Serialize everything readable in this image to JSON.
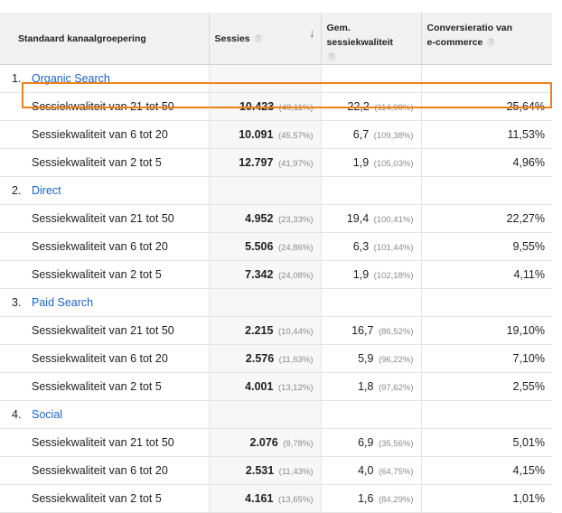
{
  "headers": {
    "channel": "Standaard kanaalgroepering",
    "sessions": "Sessies",
    "quality": "Gem. sessiekwaliteit",
    "conversion_line1": "Conversieratio van",
    "conversion_line2": "e-commerce",
    "help_glyph": "?",
    "sort_glyph": "↓"
  },
  "groups": [
    {
      "num": "1.",
      "name": "Organic Search",
      "rows": [
        {
          "label": "Sessiekwaliteit van 21 tot 50",
          "sessions": "10.423",
          "sessions_pct": "(49,11%)",
          "quality": "22,2",
          "quality_pct": "(114,98%)",
          "conversion": "25,64%"
        },
        {
          "label": "Sessiekwaliteit van 6 tot 20",
          "sessions": "10.091",
          "sessions_pct": "(45,57%)",
          "quality": "6,7",
          "quality_pct": "(109,38%)",
          "conversion": "11,53%"
        },
        {
          "label": "Sessiekwaliteit van 2 tot 5",
          "sessions": "12.797",
          "sessions_pct": "(41,97%)",
          "quality": "1,9",
          "quality_pct": "(105,03%)",
          "conversion": "4,96%"
        }
      ]
    },
    {
      "num": "2.",
      "name": "Direct",
      "rows": [
        {
          "label": "Sessiekwaliteit van 21 tot 50",
          "sessions": "4.952",
          "sessions_pct": "(23,33%)",
          "quality": "19,4",
          "quality_pct": "(100,41%)",
          "conversion": "22,27%"
        },
        {
          "label": "Sessiekwaliteit van 6 tot 20",
          "sessions": "5.506",
          "sessions_pct": "(24,86%)",
          "quality": "6,3",
          "quality_pct": "(101,44%)",
          "conversion": "9,55%"
        },
        {
          "label": "Sessiekwaliteit van 2 tot 5",
          "sessions": "7.342",
          "sessions_pct": "(24,08%)",
          "quality": "1,9",
          "quality_pct": "(102,18%)",
          "conversion": "4,11%"
        }
      ]
    },
    {
      "num": "3.",
      "name": "Paid Search",
      "rows": [
        {
          "label": "Sessiekwaliteit van 21 tot 50",
          "sessions": "2.215",
          "sessions_pct": "(10,44%)",
          "quality": "16,7",
          "quality_pct": "(86,52%)",
          "conversion": "19,10%"
        },
        {
          "label": "Sessiekwaliteit van 6 tot 20",
          "sessions": "2.576",
          "sessions_pct": "(11,63%)",
          "quality": "5,9",
          "quality_pct": "(96,22%)",
          "conversion": "7,10%"
        },
        {
          "label": "Sessiekwaliteit van 2 tot 5",
          "sessions": "4.001",
          "sessions_pct": "(13,12%)",
          "quality": "1,8",
          "quality_pct": "(97,62%)",
          "conversion": "2,55%"
        }
      ]
    },
    {
      "num": "4.",
      "name": "Social",
      "rows": [
        {
          "label": "Sessiekwaliteit van 21 tot 50",
          "sessions": "2.076",
          "sessions_pct": "(9,78%)",
          "quality": "6,9",
          "quality_pct": "(35,56%)",
          "conversion": "5,01%"
        },
        {
          "label": "Sessiekwaliteit van 6 tot 20",
          "sessions": "2.531",
          "sessions_pct": "(11,43%)",
          "quality": "4,0",
          "quality_pct": "(64,75%)",
          "conversion": "4,15%"
        },
        {
          "label": "Sessiekwaliteit van 2 tot 5",
          "sessions": "4.161",
          "sessions_pct": "(13,65%)",
          "quality": "1,6",
          "quality_pct": "(84,29%)",
          "conversion": "1,01%"
        }
      ]
    }
  ],
  "highlight": {
    "group": 0,
    "row": 0,
    "color": "#f07f1a"
  },
  "colors": {
    "link": "#1a64c8",
    "header_bg": "#f1f1f1",
    "shade": "#f7f7f7"
  }
}
